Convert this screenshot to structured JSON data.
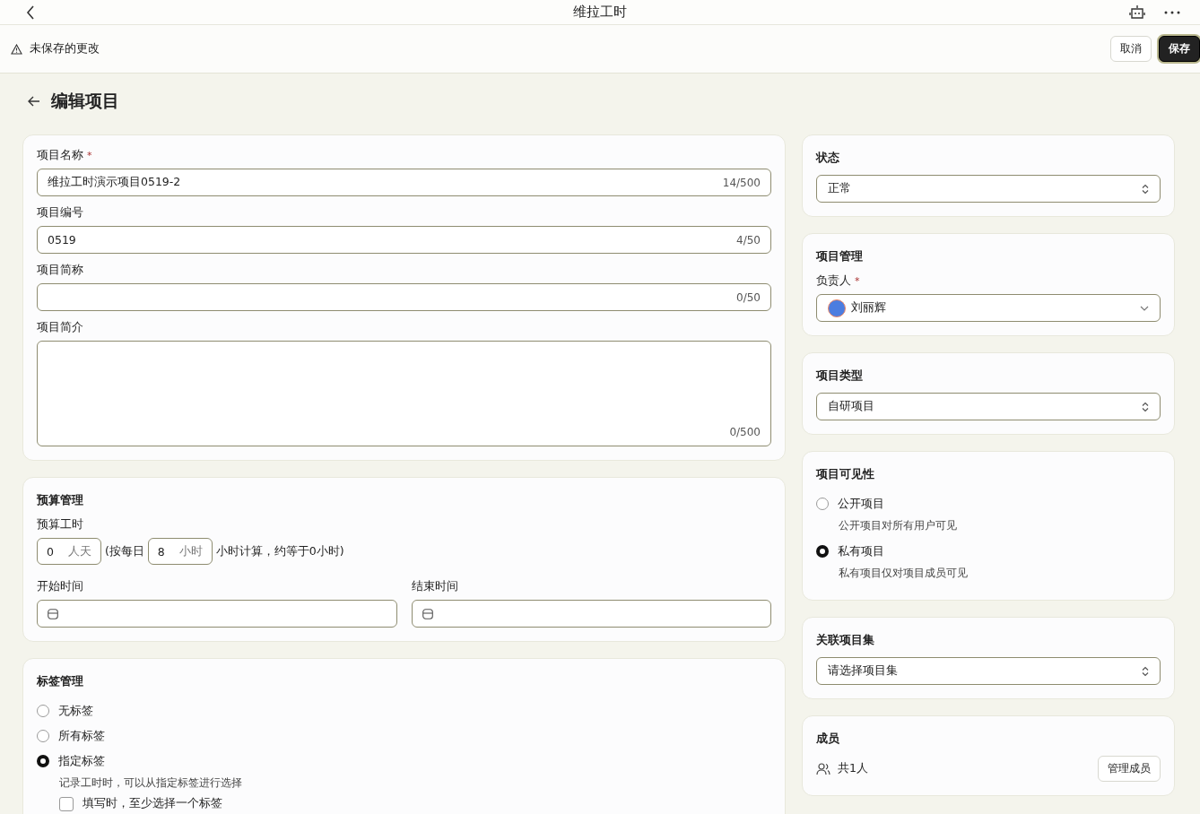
{
  "top_bar": {
    "title": "维拉工时"
  },
  "unsaved_bar": {
    "message": "未保存的更改",
    "buttons": [
      {
        "label": "取消",
        "kind": "secondary"
      },
      {
        "label": "保存",
        "kind": "primary"
      }
    ]
  },
  "page_title": "编辑项目",
  "basic_info": {
    "fields": [
      {
        "label": "项目名称",
        "required_mark": "*",
        "kind": "input",
        "value": "维拉工时演示项目0519-2",
        "counter": "14/500"
      },
      {
        "label": "项目编号",
        "kind": "input",
        "value": "0519",
        "counter": "4/50"
      },
      {
        "label": "项目简称",
        "kind": "input",
        "counter": "0/50"
      },
      {
        "label": "项目简介",
        "kind": "textarea",
        "counter": "0/500"
      }
    ]
  },
  "budget": {
    "title": "预算管理",
    "label": "预算工时",
    "days_value": "0",
    "days_unit": "人天",
    "text_before": "(按每日",
    "hours_value": "8",
    "hours_unit": "小时",
    "text_after": "小时计算，约等于0小时)",
    "start_label": "开始时间",
    "end_label": "结束时间"
  },
  "tags": {
    "title": "标签管理",
    "options": [
      {
        "label": "无标签",
        "selected": false
      },
      {
        "label": "所有标签",
        "selected": false
      },
      {
        "label": "指定标签",
        "selected": true,
        "hint": "记录工时时，可以从指定标签进行选择",
        "checkbox": {
          "label": "填写时，至少选择一个标签",
          "checked": false
        }
      }
    ]
  },
  "status": {
    "title": "状态",
    "value": "正常"
  },
  "management": {
    "title": "项目管理",
    "owner_label": "负责人",
    "required_mark": "*",
    "owner": "刘丽辉"
  },
  "project_type": {
    "title": "项目类型",
    "value": "自研项目"
  },
  "visibility": {
    "title": "项目可见性",
    "options": [
      {
        "label": "公开项目",
        "description": "公开项目对所有用户可见",
        "selected": false
      },
      {
        "label": "私有项目",
        "description": "私有项目仅对项目成员可见",
        "selected": true
      }
    ]
  },
  "collection": {
    "title": "关联项目集",
    "placeholder": "请选择项目集"
  },
  "members": {
    "title": "成员",
    "count": "共1人",
    "button": "管理成员"
  }
}
